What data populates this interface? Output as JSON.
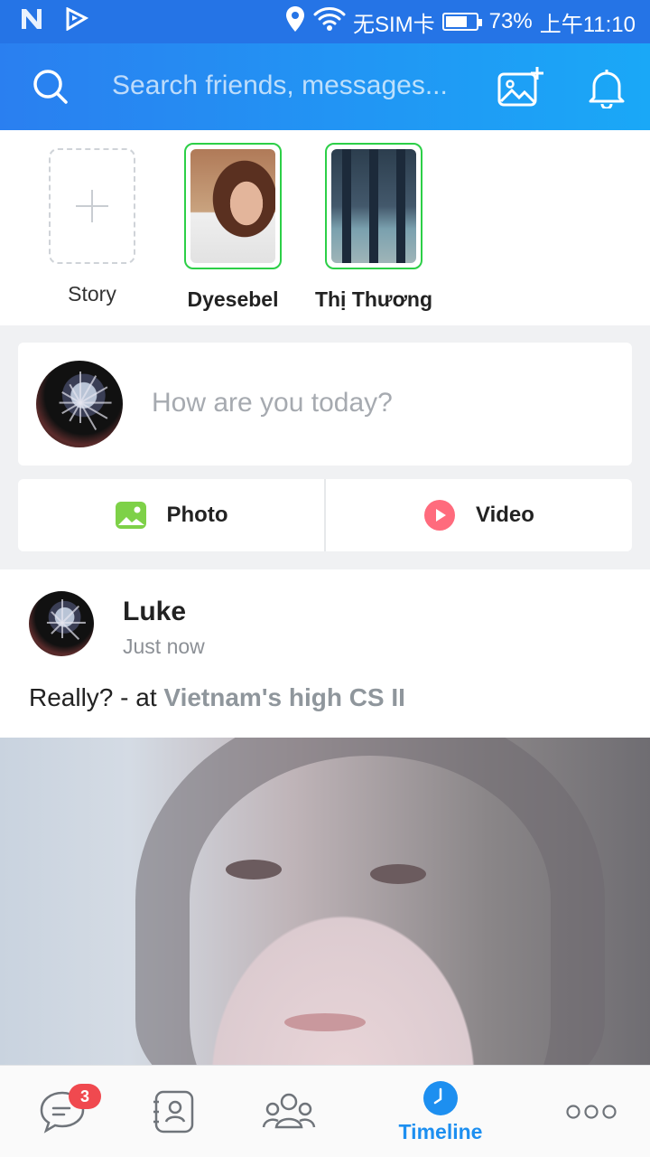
{
  "status_bar": {
    "carrier": "无SIM卡",
    "battery": "73%",
    "battery_level": 0.73,
    "time": "上午11:10"
  },
  "header": {
    "search_placeholder": "Search friends, messages..."
  },
  "stories": {
    "add_label": "Story",
    "items": [
      {
        "name": "Dyesebel"
      },
      {
        "name": "Thị Thương"
      }
    ]
  },
  "compose": {
    "prompt": "How are you today?",
    "photo_label": "Photo",
    "video_label": "Video"
  },
  "post": {
    "author": "Luke",
    "time": "Just now",
    "text": "Really? - at ",
    "location": "Vietnam's high CS II"
  },
  "bottom_nav": {
    "messages_badge": "3",
    "timeline_label": "Timeline",
    "active_color": "#1d8ff0"
  },
  "colors": {
    "header_start": "#2a7ff0",
    "header_end": "#1aa8f7",
    "story_ring": "#2ccf47",
    "badge": "#f0494f"
  }
}
